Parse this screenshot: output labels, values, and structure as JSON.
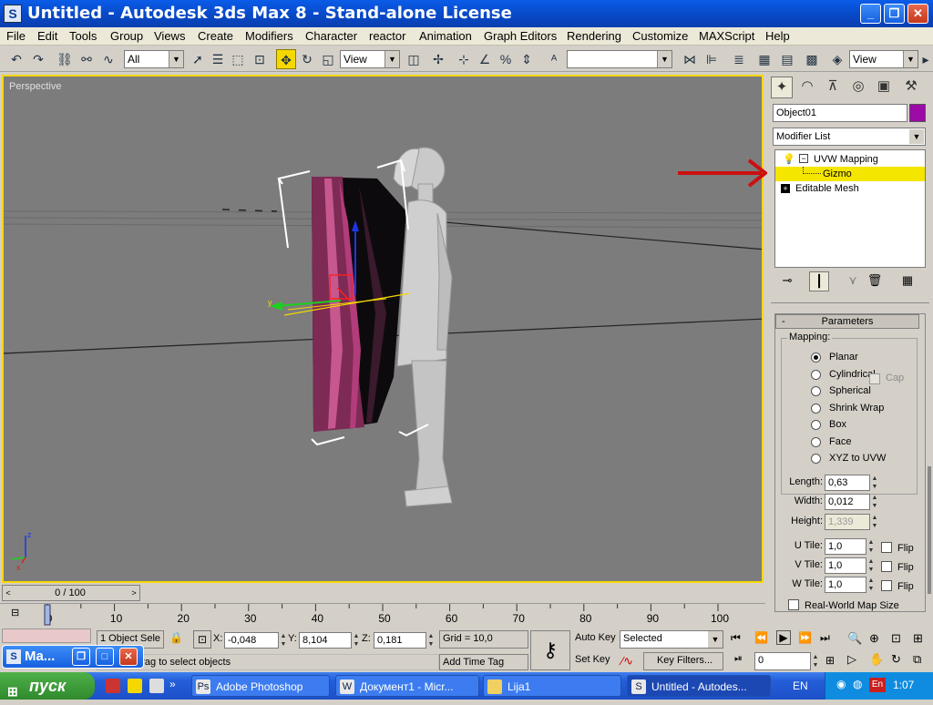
{
  "window": {
    "title": "Untitled - Autodesk 3ds Max 8  - Stand-alone License",
    "icon": "3ds-max-icon"
  },
  "menu": [
    "File",
    "Edit",
    "Tools",
    "Group",
    "Views",
    "Create",
    "Modifiers",
    "Character",
    "reactor",
    "Animation",
    "Graph Editors",
    "Rendering",
    "Customize",
    "MAXScript",
    "Help"
  ],
  "toolbar": {
    "selection_filter": "All",
    "ref_coord": "View",
    "named_selection": "",
    "ref_coord2": "View"
  },
  "viewport": {
    "label": "Perspective",
    "axis_z": "z",
    "axis_x": "x",
    "gizmo_y": "y"
  },
  "command_panel": {
    "object_name": "Object01",
    "object_color": "#9c0aa8",
    "modifier_list": "Modifier List",
    "stack": [
      {
        "label": "UVW Mapping",
        "selected": false
      },
      {
        "label": "Gizmo",
        "selected": true
      },
      {
        "label": "Editable Mesh",
        "selected": false
      }
    ],
    "parameters": {
      "rollout_title": "Parameters",
      "rollout_toggle": "-",
      "mapping_label": "Mapping:",
      "mapping_options": [
        "Planar",
        "Cylindrical",
        "Spherical",
        "Shrink Wrap",
        "Box",
        "Face",
        "XYZ to UVW"
      ],
      "selected_mapping": "Planar",
      "cap_label": "Cap",
      "length_label": "Length:",
      "length": "0,63",
      "width_label": "Width:",
      "width": "0,012",
      "height_label": "Height:",
      "height": "1,339",
      "u_tile_label": "U Tile:",
      "u_tile": "1,0",
      "v_tile_label": "V Tile:",
      "v_tile": "1,0",
      "w_tile_label": "W Tile:",
      "w_tile": "1,0",
      "flip_label": "Flip",
      "real_world_label": "Real-World Map Size"
    }
  },
  "timeline": {
    "frame": "0 / 100",
    "ticks": [
      "0",
      "10",
      "20",
      "30",
      "40",
      "50",
      "60",
      "70",
      "80",
      "90",
      "100"
    ],
    "current_fraction": 0.0
  },
  "status": {
    "selection": "1 Object Sele",
    "prompt": "ick-and-drag to select objects",
    "x_label": "X:",
    "x": "-0,048",
    "y_label": "Y:",
    "y": "8,104",
    "z_label": "Z:",
    "z": "0,181",
    "grid": "Grid = 10,0",
    "add_time_tag": "Add Time Tag",
    "auto_key": "Auto Key",
    "set_key": "Set Key",
    "key_mode": "Selected",
    "key_filters": "Key Filters...",
    "frame_field": "0",
    "floating_window": "Ma..."
  },
  "taskbar": {
    "start": "пуск",
    "tasks": [
      {
        "label": "Adobe Photoshop",
        "icon": "photoshop-icon",
        "active": false
      },
      {
        "label": "Документ1 - Micr...",
        "icon": "word-icon",
        "active": false
      },
      {
        "label": "Lija1",
        "icon": "folder-icon",
        "active": false
      },
      {
        "label": "Untitled - Autodes...",
        "icon": "3ds-max-icon",
        "active": true
      }
    ],
    "language": "EN",
    "tray_lang": "En",
    "clock": "1:07"
  },
  "colors": {
    "accent_yellow": "#f5d800",
    "title_blue": "#0a5ce8",
    "viewport_bg": "#7c7c7c",
    "annotation_arrow": "#cc1010"
  }
}
